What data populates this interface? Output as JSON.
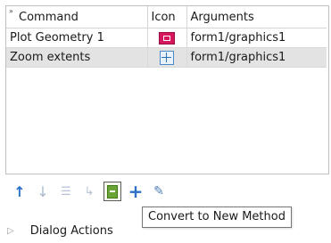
{
  "table": {
    "headers": {
      "sort_icon": "sort-arrows-icon",
      "command": "Command",
      "icon": "Icon",
      "arguments": "Arguments"
    },
    "rows": [
      {
        "command": "Plot Geometry 1",
        "icon": "plot-geometry-icon",
        "arguments": "form1/graphics1",
        "selected": false
      },
      {
        "command": "Zoom extents",
        "icon": "zoom-extents-icon",
        "arguments": "form1/graphics1",
        "selected": true
      }
    ]
  },
  "toolbar": {
    "buttons": [
      {
        "icon": "move-up-icon"
      },
      {
        "icon": "move-down-icon"
      },
      {
        "icon": "delete-list-icon"
      },
      {
        "icon": "insert-icon"
      },
      {
        "icon": "convert-to-new-method-icon"
      },
      {
        "icon": "add-icon"
      },
      {
        "icon": "edit-icon"
      }
    ]
  },
  "tooltip": {
    "text": "Convert to New Method"
  },
  "section": {
    "label": "Dialog Actions",
    "icon": "chevron-right-icon"
  }
}
